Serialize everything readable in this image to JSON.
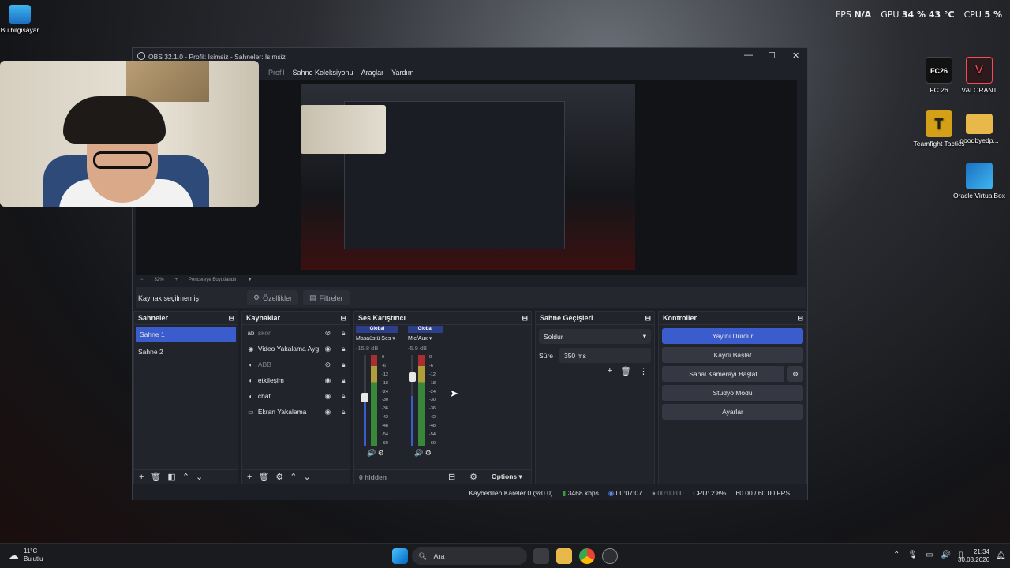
{
  "hud": {
    "fps_label": "FPS",
    "fps_value": "N/A",
    "gpu_label": "GPU",
    "gpu_value": "34 % 43 °C",
    "cpu_label": "CPU",
    "cpu_value": "5 %"
  },
  "desktop": {
    "this_pc": "Bu bilgisayar",
    "fc26": "FC 26",
    "valorant": "VALORANT",
    "tft": "Teamfight Tactics",
    "goodbye": "goodbyedp...",
    "vbox": "Oracle VirtualBox"
  },
  "window": {
    "title": "OBS 32.1.0 - Profil: İsimsiz - Sahneler: İsimsiz"
  },
  "menu": {
    "profile": "Profil",
    "scene_collection": "Sahne Koleksiyonu",
    "tools": "Araçlar",
    "help": "Yardım"
  },
  "zoom": {
    "minus": "−",
    "percent": "32%",
    "plus": "+",
    "fit": "Pencereye Boyutlandır"
  },
  "source_bar": {
    "no_source": "Kaynak seçilmemiş",
    "properties": "Özellikler",
    "filters": "Filtreler"
  },
  "scenes": {
    "title": "Sahneler",
    "items": [
      "Sahne 1",
      "Sahne 2"
    ]
  },
  "sources": {
    "title": "Kaynaklar",
    "items": [
      {
        "icon": "ab",
        "name": "skor",
        "dim": true
      },
      {
        "icon": "◉",
        "name": "Video Yakalama Aygıtı",
        "dim": false
      },
      {
        "icon": "◐",
        "name": "ABB",
        "dim": true
      },
      {
        "icon": "◐",
        "name": "etkileşim",
        "dim": false
      },
      {
        "icon": "◐",
        "name": "chat",
        "dim": false
      },
      {
        "icon": "▭",
        "name": "Ekran Yakalama",
        "dim": false
      }
    ]
  },
  "mixer": {
    "title": "Ses Karıştırıcı",
    "channels": [
      {
        "tag": "Global",
        "name": "Masaüstü Ses",
        "db": "-15.8 dB"
      },
      {
        "tag": "Global",
        "name": "Mic/Aux",
        "db": "-5.9 dB"
      }
    ],
    "scale": [
      "0",
      "-6",
      "-12",
      "-18",
      "-24",
      "-30",
      "-36",
      "-42",
      "-48",
      "-54",
      "-60"
    ],
    "hidden": "0 hidden",
    "options": "Options"
  },
  "transitions": {
    "title": "Sahne Geçişleri",
    "type": "Soldur",
    "duration_label": "Süre",
    "duration_value": "350 ms"
  },
  "controls": {
    "title": "Kontroller",
    "stop_stream": "Yayını Durdur",
    "start_record": "Kaydı Başlat",
    "start_vcam": "Sanal Kamerayı Başlat",
    "studio": "Stüdyo Modu",
    "settings": "Ayarlar"
  },
  "status": {
    "dropped": "Kaybedilen Kareler 0 (%0.0)",
    "bitrate": "3468 kbps",
    "stream_time": "00:07:07",
    "record_time": "00:00:00",
    "cpu": "CPU: 2.8%",
    "fps": "60.00 / 60.00 FPS"
  },
  "taskbar": {
    "temp": "11°C",
    "weather": "Bulutlu",
    "search": "Ara",
    "time": "21:34",
    "date": "30.03.2026"
  }
}
